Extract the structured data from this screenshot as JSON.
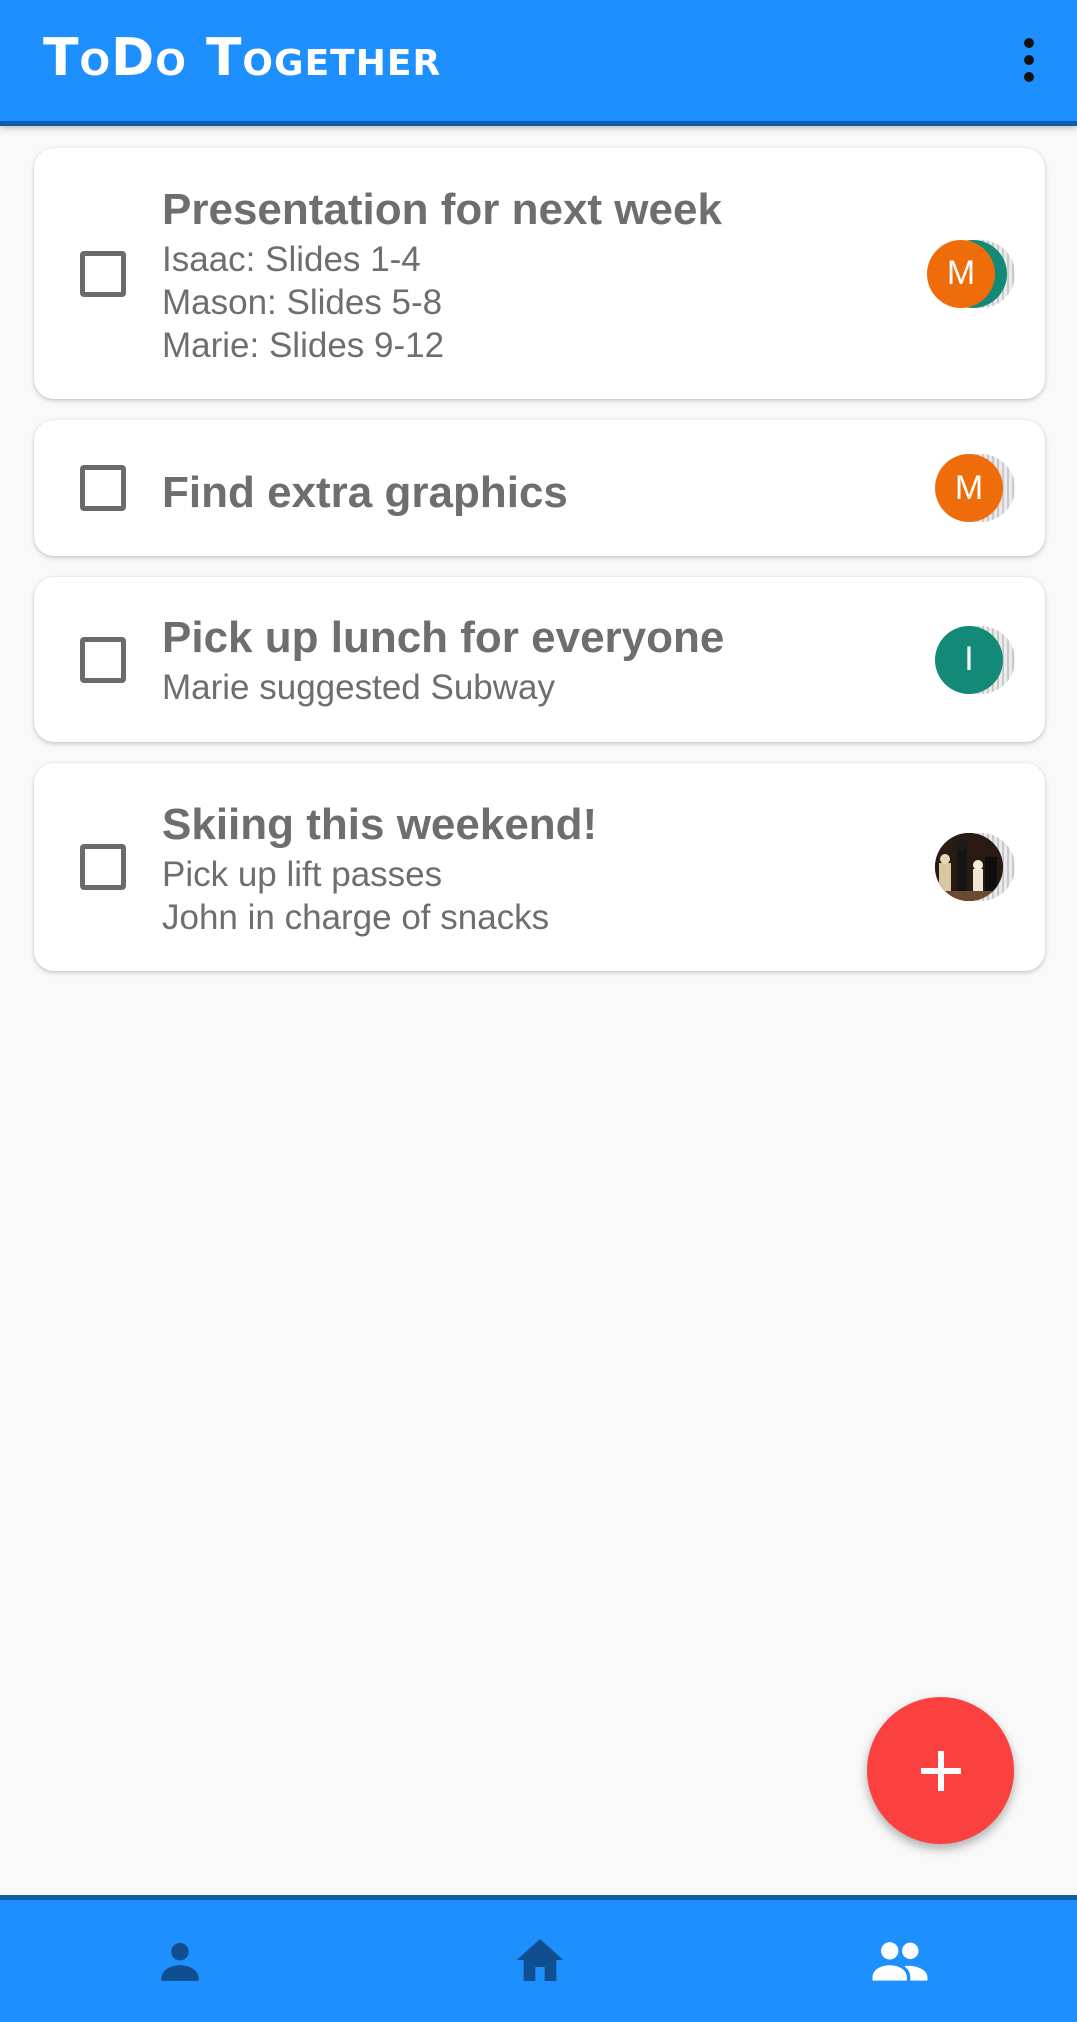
{
  "app": {
    "title": "ToDo Together",
    "more_icon": "more-vert-icon"
  },
  "colors": {
    "primary": "#1e8fff",
    "primary_dark": "#0f5ea8",
    "fab": "#fb4140",
    "avatar_orange": "#ef6c0a",
    "avatar_teal": "#138a78",
    "text": "#6e6e6e"
  },
  "tasks": [
    {
      "title": "Presentation for next week",
      "notes": [
        "Isaac: Slides 1-4",
        "Mason: Slides 5-8",
        "Marie: Slides 9-12"
      ],
      "checked": false,
      "avatar_initial": "M"
    },
    {
      "title": "Find extra graphics",
      "notes": [],
      "checked": false,
      "avatar_initial": "M"
    },
    {
      "title": "Pick up lunch for everyone",
      "notes": [
        "Marie suggested Subway"
      ],
      "checked": false,
      "avatar_initial": "I"
    },
    {
      "title": "Skiing this weekend!",
      "notes": [
        "Pick up lift passes",
        "John in charge of snacks"
      ],
      "checked": false,
      "avatar_initial": ""
    }
  ],
  "fab": {
    "icon": "plus-icon"
  },
  "bottom_nav": [
    {
      "icon": "person-icon"
    },
    {
      "icon": "home-icon"
    },
    {
      "icon": "group-icon"
    }
  ]
}
